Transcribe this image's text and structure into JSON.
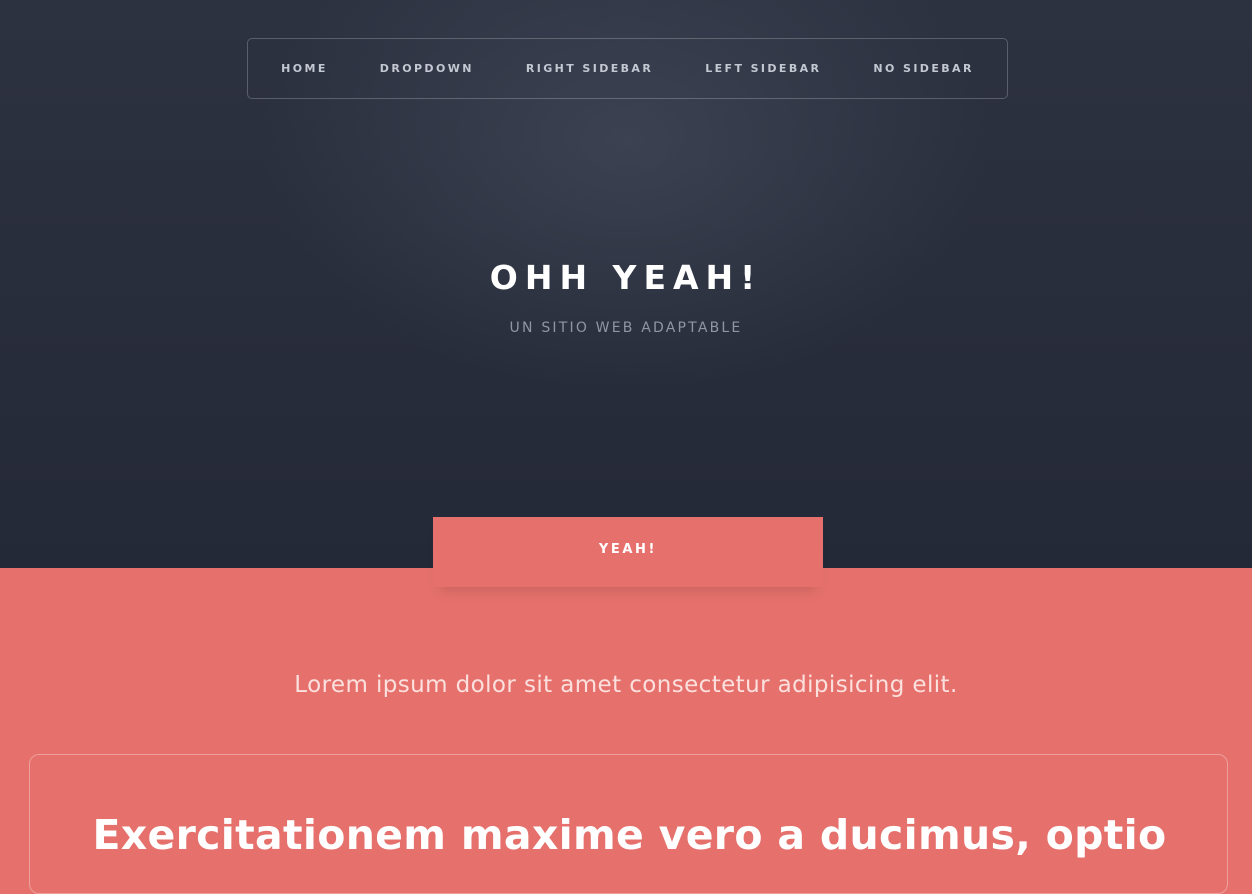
{
  "nav": {
    "items": [
      {
        "label": "HOME"
      },
      {
        "label": "DROPDOWN"
      },
      {
        "label": "RIGHT SIDEBAR"
      },
      {
        "label": "LEFT SIDEBAR"
      },
      {
        "label": "NO SIDEBAR"
      }
    ]
  },
  "hero": {
    "title": "OHH YEAH!",
    "subtitle": "UN SITIO WEB ADAPTABLE"
  },
  "cta": {
    "label": "YEAH!"
  },
  "main": {
    "lead": "Lorem ipsum dolor sit amet consectetur adipisicing elit.",
    "card_title": "Exercitationem maxime vero a ducimus, optio"
  },
  "colors": {
    "hero_bg": "#282d3b",
    "accent": "#e6716c",
    "text_light": "#ffffff"
  }
}
